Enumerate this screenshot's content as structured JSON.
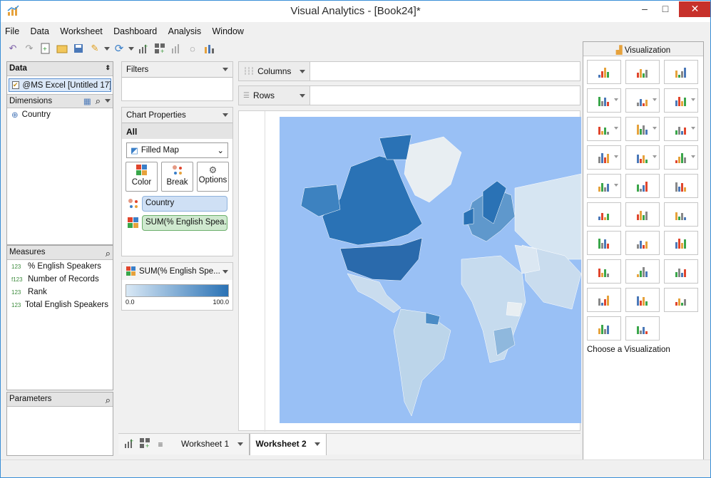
{
  "window": {
    "title": "Visual Analytics - [Book24]*"
  },
  "menu": [
    "File",
    "Data",
    "Worksheet",
    "Dashboard",
    "Analysis",
    "Window"
  ],
  "data_panel": {
    "header": "Data",
    "datasource": "@MS Excel [Untitled 17]",
    "dimensions_label": "Dimensions",
    "dimensions": [
      "Country"
    ],
    "measures_label": "Measures",
    "measures": [
      {
        "type": "123",
        "name": "% English Speakers"
      },
      {
        "type": "f123",
        "name": "Number of Records"
      },
      {
        "type": "123",
        "name": "Rank"
      },
      {
        "type": "123",
        "name": "Total English Speakers"
      }
    ],
    "parameters_label": "Parameters"
  },
  "filters": {
    "label": "Filters"
  },
  "chart_properties": {
    "label": "Chart Properties",
    "all_label": "All",
    "chart_type": "Filled Map",
    "buttons": [
      "Color",
      "Break",
      "Options"
    ],
    "break_pill": "Country",
    "color_pill": "SUM(% English Spea..."
  },
  "legend": {
    "title": "SUM(% English Spe...",
    "min": "0.0",
    "max": "100.0",
    "color_low": "#d9e8f5",
    "color_high": "#2a72b5"
  },
  "shelves": {
    "columns": "Columns",
    "rows": "Rows"
  },
  "visualization": {
    "header": "Visualization",
    "footer": "Choose a Visualization",
    "icons": [
      "text-table-icon",
      "heat-map-icon",
      "highlight-table-icon",
      "stacked-bar-icon",
      "side-by-side-bar-icon",
      "bar-chart-icon",
      "line-chart-icon",
      "dual-line-icon",
      "discrete-line-icon",
      "area-chart-icon",
      "stacked-area-icon",
      "area-comparison-icon",
      "filled-area-icon",
      "histogram-icon",
      "scatter-plot-icon",
      "symbol-map-icon",
      "filled-map-icon",
      "pie-chart-icon",
      "donut-chart-icon",
      "tree-map-icon",
      "box-plot-icon",
      "bullet-chart-icon",
      "funnel-chart-icon",
      "gauge-icon",
      "mountain-chart-icon",
      "packed-bars-icon",
      "radar-chart-icon",
      "column-chart-icon",
      "candlestick-icon"
    ]
  },
  "sheets": {
    "tabs": [
      "Worksheet 1",
      "Worksheet 2"
    ],
    "active": "Worksheet 2"
  },
  "colors": {
    "accent": "#3a8fd7",
    "ocean": "#99c0f5",
    "land": "#e8eef2",
    "close": "#c7312b"
  }
}
